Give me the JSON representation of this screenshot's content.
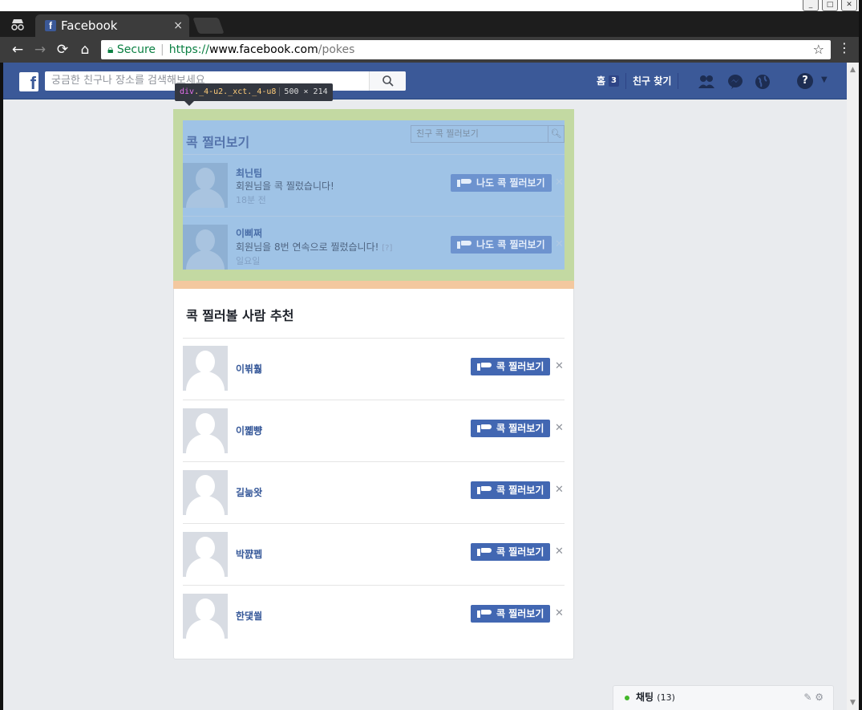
{
  "browser": {
    "tab_title": "Facebook",
    "tab_close": "×",
    "secure_label": "Secure",
    "url_protocol": "https://",
    "url_host": "www.facebook.com",
    "url_path": "/pokes",
    "win_min": "_",
    "win_max": "□",
    "win_close": "✕"
  },
  "header": {
    "logo": "f",
    "search_placeholder": "궁금한 친구나 장소를 검색해보세요",
    "home_label": "홈",
    "home_count": "3",
    "find_friends_label": "친구 찾기"
  },
  "devtools_tooltip": {
    "tag": "div",
    "classes": "._4-u2._xct._4-u8",
    "size": "500 × 214"
  },
  "pokes": {
    "title": "콕 찔러보기",
    "search_placeholder": "친구 콕 찔러보기",
    "items": [
      {
        "name": "최닌팀",
        "message": "회원님을 콕 찔렀습니다!",
        "help": "",
        "time": "18분 전",
        "button": "나도 콕 찔러보기"
      },
      {
        "name": "이삐쩌",
        "message": "회원님을 8번 연속으로 찔렀습니다!",
        "help": "[?]",
        "time": "일요일",
        "button": "나도 콕 찔러보기"
      }
    ]
  },
  "suggestions": {
    "title": "콕 찔러볼 사람 추천",
    "items": [
      {
        "name": "이뷖훯",
        "button": "콕 찔러보기"
      },
      {
        "name": "이쩳뺭",
        "button": "콕 찔러보기"
      },
      {
        "name": "길늚왓",
        "button": "콕 찔러보기"
      },
      {
        "name": "박쨠펩",
        "button": "콕 찔러보기"
      },
      {
        "name": "한댗쐴",
        "button": "콕 찔러보기"
      }
    ]
  },
  "chat": {
    "label": "채팅",
    "count": "(13)"
  },
  "icons": {
    "incognito": "incognito-icon",
    "back": "back-arrow-icon",
    "forward": "forward-arrow-icon",
    "reload": "reload-icon",
    "home": "home-icon",
    "lock": "lock-icon",
    "star": "star-icon",
    "menu": "menu-dots-icon",
    "search": "search-icon",
    "friends": "friend-requests-icon",
    "messenger": "messenger-icon",
    "globe": "notifications-globe-icon",
    "help": "help-icon",
    "hand": "poke-hand-icon",
    "dismiss": "dismiss-x-icon"
  },
  "colors": {
    "fb_blue": "#3b5998",
    "button_blue": "#4267b2",
    "highlight_content": "#9fc3e6",
    "highlight_padding": "#c3d9a2",
    "highlight_margin": "#f3c89f",
    "online_green": "#42b72a"
  }
}
